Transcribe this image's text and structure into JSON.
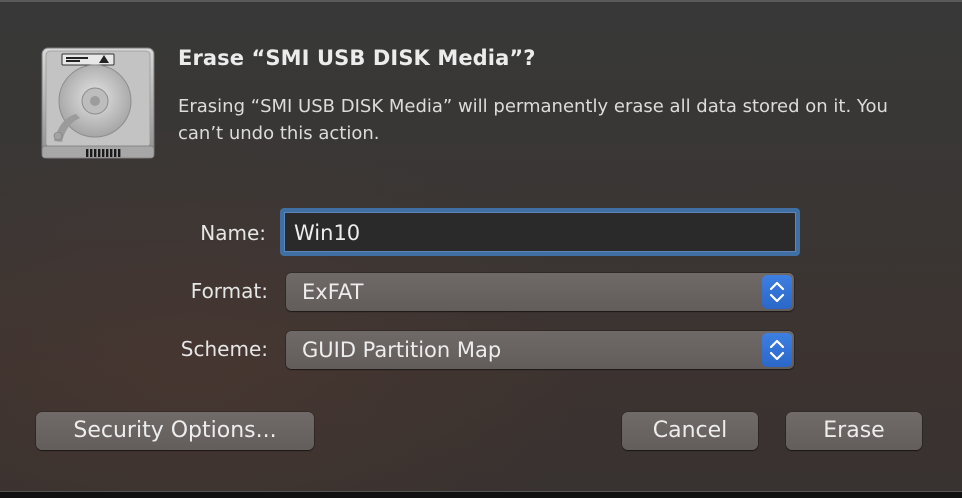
{
  "dialog": {
    "title": "Erase “SMI USB DISK Media”?",
    "message": "Erasing “SMI USB DISK Media” will permanently erase all data stored on it. You can’t undo this action."
  },
  "form": {
    "name_label": "Name:",
    "name_value": "Win10",
    "format_label": "Format:",
    "format_value": "ExFAT",
    "scheme_label": "Scheme:",
    "scheme_value": "GUID Partition Map"
  },
  "buttons": {
    "security_options": "Security Options...",
    "cancel": "Cancel",
    "erase": "Erase"
  },
  "icons": {
    "disk": "external-disk-icon",
    "stepper": "popup-stepper-icon"
  },
  "colors": {
    "accent": "#2f6fd6",
    "focus_ring": "#3f6fa3"
  }
}
